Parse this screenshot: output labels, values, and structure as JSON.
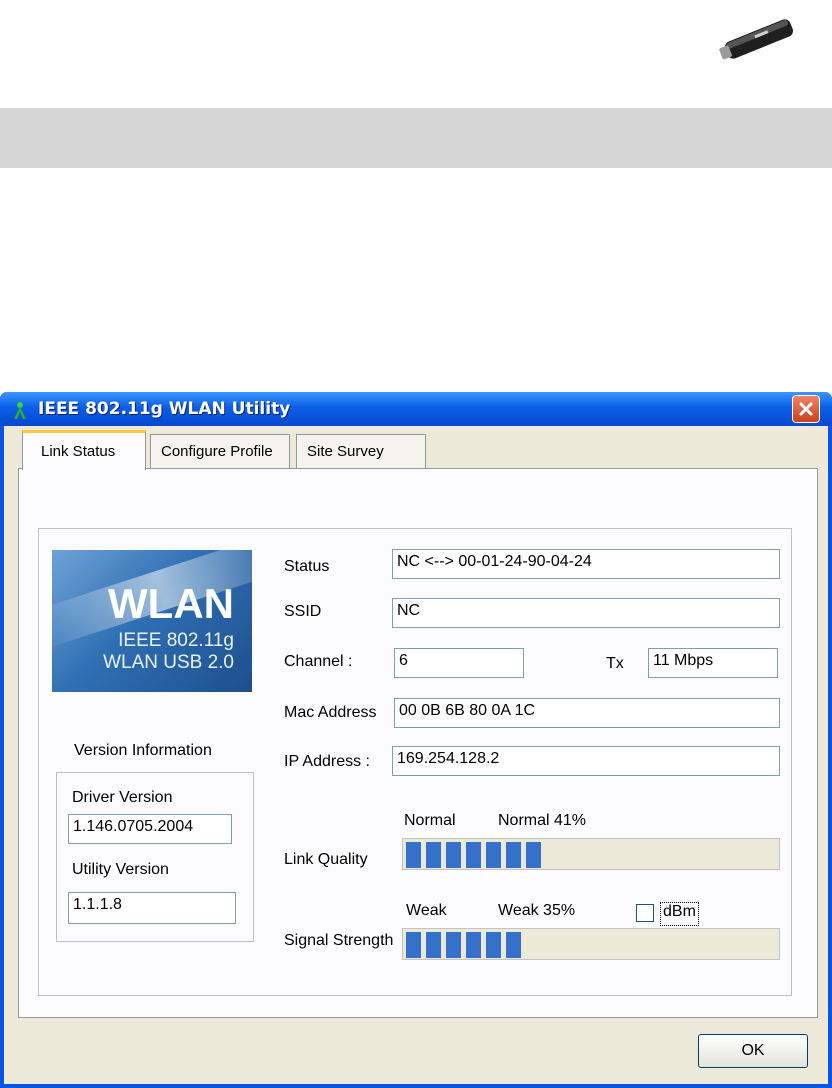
{
  "window": {
    "title": "IEEE 802.11g WLAN Utility"
  },
  "tabs": [
    "Link Status",
    "Configure Profile",
    "Site Survey"
  ],
  "logo": {
    "line1": "WLAN",
    "line2": "IEEE 802.11g",
    "line3": "WLAN USB 2.0"
  },
  "version": {
    "heading": "Version Information",
    "driver_label": "Driver Version",
    "driver_value": "1.146.0705.2004",
    "utility_label": "Utility Version",
    "utility_value": "1.1.1.8"
  },
  "status": {
    "status_label": "Status",
    "status_value": "NC <--> 00-01-24-90-04-24",
    "ssid_label": "SSID",
    "ssid_value": "NC",
    "channel_label": "Channel :",
    "channel_value": "6",
    "tx_label": "Tx",
    "tx_value": "11 Mbps",
    "mac_label": "Mac Address",
    "mac_value": "00 0B 6B 80 0A 1C",
    "ip_label": "IP Address :",
    "ip_value": "169.254.128.2"
  },
  "link_quality": {
    "label": "Link Quality",
    "level": "Normal",
    "text": "Normal 41%",
    "percent": 41
  },
  "signal_strength": {
    "label": "Signal Strength",
    "level": "Weak",
    "text": "Weak 35%",
    "percent": 35
  },
  "dbm_label": "dBm",
  "dbm_checked": false,
  "ok_label": "OK",
  "colors": {
    "titlebar": "#0a5fe6",
    "bar_fill": "#3571ca",
    "dialog_bg": "#ece9d8"
  },
  "icons": [
    "usb-adapter-icon",
    "wlan-antenna-icon",
    "close-icon"
  ]
}
